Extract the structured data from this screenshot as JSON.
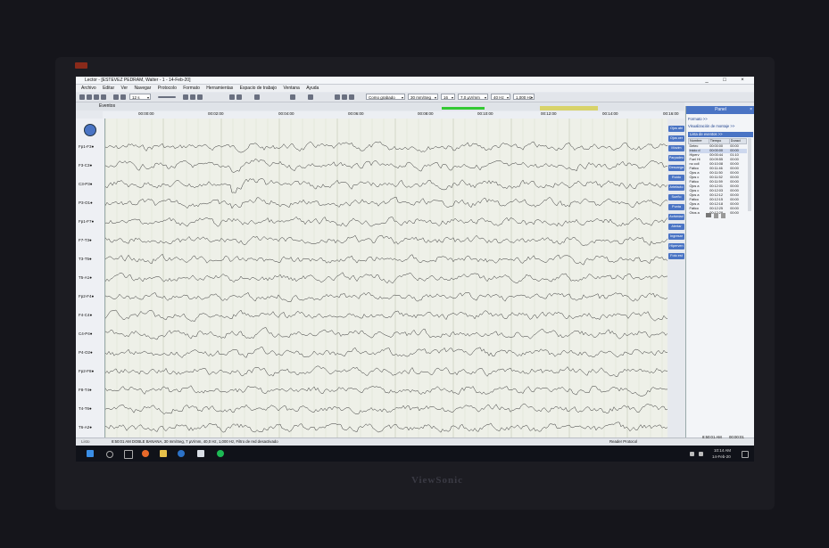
{
  "window": {
    "title": "Lector - [ESTEVEZ PEDRAM, Walter - 1 - 14-Feb-20]",
    "buttons": [
      "_",
      "□",
      "×"
    ]
  },
  "menu": [
    "Archivo",
    "Editar",
    "Ver",
    "Navegar",
    "Protocolo",
    "Formato",
    "Herramientas",
    "Espacio de trabajo",
    "Ventana",
    "Ayuda"
  ],
  "toolbar": {
    "page_combo": "12 s",
    "montage": "Como grabado",
    "speed": "30 mm/Seg",
    "count": "16",
    "sensitivity": "7,0 µV/mm",
    "filter_hz": "40 Hz",
    "filter_low": "1,000 Hz"
  },
  "events_label": "Eventos",
  "time_axis": [
    "00:00:00",
    "00:02:00",
    "00:04:00",
    "00:06:00",
    "00:08:00",
    "00:10:00",
    "00:12:00",
    "00:14:00",
    "00:16:00"
  ],
  "channels": [
    "Fp1-F3●",
    "F3-C3●",
    "C3-P3●",
    "P3-O1●",
    "Fp1-F7●",
    "F7-T3●",
    "T3-T5●",
    "T5-A1●",
    "Fp2-F4●",
    "F4-C4●",
    "C4-P4●",
    "P4-O2●",
    "Fp2-F8●",
    "F8-T4●",
    "T4-T6●",
    "T6-A2●"
  ],
  "side_buttons": [
    "Ojos abi",
    "Ojos cer",
    "Movim",
    "Parpadeo",
    "Descarga",
    "Ruido",
    "Artefacto",
    "Sueño",
    "Punta",
    "Actividad",
    "Alertar",
    "Ingresar",
    "Hiperven",
    "Foto est"
  ],
  "panel": {
    "title": "Panel",
    "close": "×",
    "link1": "Formato >>",
    "link2": "Visualización de montaje >>",
    "events_header": "Lista de eventos >>",
    "columns": [
      "Nombre",
      "Tiempo",
      "Duraci"
    ],
    "rows": [
      [
        "Detec",
        "00:00:00",
        "00:00"
      ],
      [
        "Inicio d",
        "00:00:00",
        "00:00"
      ],
      [
        "Hiperv",
        "00:00:44",
        "01:10"
      ],
      [
        "Fuel Hi",
        "00:09:55",
        "00:00"
      ],
      [
        "no coll",
        "00:10:08",
        "00:00"
      ],
      [
        "Fático",
        "00:11:46",
        "00:00"
      ],
      [
        "Ojos a",
        "00:11:50",
        "00:00"
      ],
      [
        "Ojos c",
        "00:11:52",
        "00:00"
      ],
      [
        "Fático",
        "00:11:59",
        "00:00"
      ],
      [
        "Ojos a",
        "00:12:01",
        "00:00"
      ],
      [
        "Ojos c",
        "00:12:03",
        "00:00"
      ],
      [
        "Ojos a",
        "00:12:12",
        "00:00"
      ],
      [
        "Fático",
        "00:12:15",
        "00:00"
      ],
      [
        "Ojos a",
        "00:12:18",
        "00:00"
      ],
      [
        "Fático",
        "00:12:25",
        "00:00"
      ],
      [
        "Otos a",
        "00:12:28",
        "00:00"
      ]
    ]
  },
  "status": {
    "left": "8:50:01 AM DOBLE BANANA, 30 mm/Seg, 7 µV/mm, 40,0 Hz, 1,000 Hz, Filtro de red desactivado",
    "center": "Reader Protocol",
    "clock": "8:50:01 AM",
    "elapsed": "00:00:01"
  },
  "taskbar": {
    "listo": "Listo",
    "time": "10:14 AM",
    "date": "14-Feb-20"
  },
  "brand": "ViewSonic",
  "colors": {
    "accent": "#4a74c4",
    "progress": "#34c934",
    "trace": "#333"
  }
}
